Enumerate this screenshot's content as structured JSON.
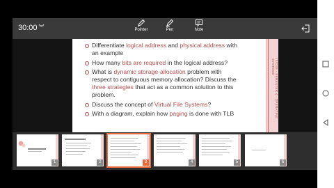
{
  "toolbar": {
    "timer": "30:00",
    "tools": [
      {
        "label": "Pointer",
        "icon": "pointer-pen-icon"
      },
      {
        "label": "Pen",
        "icon": "pen-icon"
      },
      {
        "label": "Note",
        "icon": "note-icon"
      }
    ],
    "exit_icon": "exit-icon"
  },
  "slide": {
    "side_text": "IT/CSE - SEMESTER 4 - OPERATING SYSTEMS",
    "bullets": [
      {
        "pre": "Differentiate ",
        "hl1": "logical address",
        "mid": " and ",
        "hl2": "physical address",
        "post": " with an example"
      },
      {
        "pre": "How many ",
        "hl1": "bits are required",
        "mid": " in the logical address?",
        "hl2": "",
        "post": ""
      },
      {
        "pre": "What is ",
        "hl1": "dynamic storage-allocation",
        "mid": " problem with respect to contiguous memory allocation? Discuss the ",
        "hl2": "three strategies",
        "post": " that act as a common solution to this problem."
      },
      {
        "pre": "Discuss the concept of ",
        "hl1": "Virtual File Systems",
        "mid": "?",
        "hl2": "",
        "post": ""
      },
      {
        "pre": "With a diagram, explain how ",
        "hl1": "paging",
        "mid": " is done with TLB",
        "hl2": "",
        "post": ""
      }
    ]
  },
  "thumbnails": [
    {
      "num": "1",
      "active": false
    },
    {
      "num": "2",
      "active": false
    },
    {
      "num": "3",
      "active": true
    },
    {
      "num": "4",
      "active": false
    },
    {
      "num": "5",
      "active": false
    },
    {
      "num": "6",
      "active": false
    }
  ],
  "colors": {
    "accent": "#e46b3e",
    "highlight": "#b24b4b",
    "toolbar": "#3a3a3a"
  }
}
